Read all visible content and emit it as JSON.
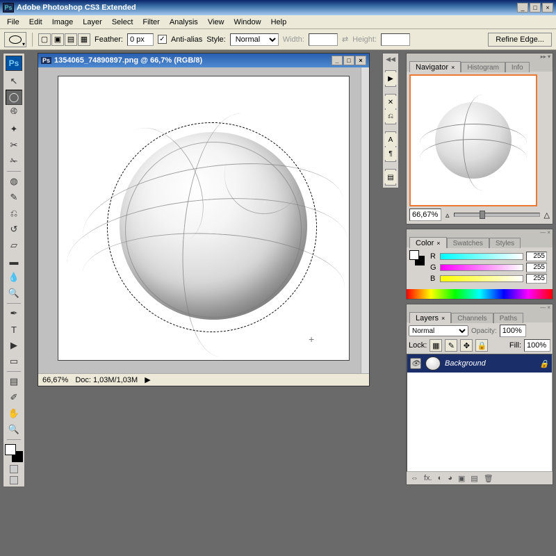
{
  "app": {
    "title": "Adobe Photoshop CS3 Extended"
  },
  "menu": {
    "items": [
      "File",
      "Edit",
      "Image",
      "Layer",
      "Select",
      "Filter",
      "Analysis",
      "View",
      "Window",
      "Help"
    ]
  },
  "options": {
    "feather_label": "Feather:",
    "feather_value": "0 px",
    "antialias_label": "Anti-alias",
    "style_label": "Style:",
    "style_value": "Normal",
    "width_label": "Width:",
    "height_label": "Height:",
    "refine_label": "Refine Edge..."
  },
  "document": {
    "title": "1354065_74890897.png @ 66,7% (RGB/8)",
    "zoom": "66,67%",
    "docsize": "Doc: 1,03M/1,03M"
  },
  "navigator": {
    "tabs": [
      "Navigator",
      "Histogram",
      "Info"
    ],
    "zoom": "66,67%"
  },
  "color": {
    "tabs": [
      "Color",
      "Swatches",
      "Styles"
    ],
    "channels": {
      "r_label": "R",
      "g_label": "G",
      "b_label": "B"
    },
    "r": "255",
    "g": "255",
    "b": "255"
  },
  "layers": {
    "tabs": [
      "Layers",
      "Channels",
      "Paths"
    ],
    "blend_mode": "Normal",
    "opacity_label": "Opacity:",
    "opacity": "100%",
    "lock_label": "Lock:",
    "fill_label": "Fill:",
    "fill": "100%",
    "layer_name": "Background"
  }
}
